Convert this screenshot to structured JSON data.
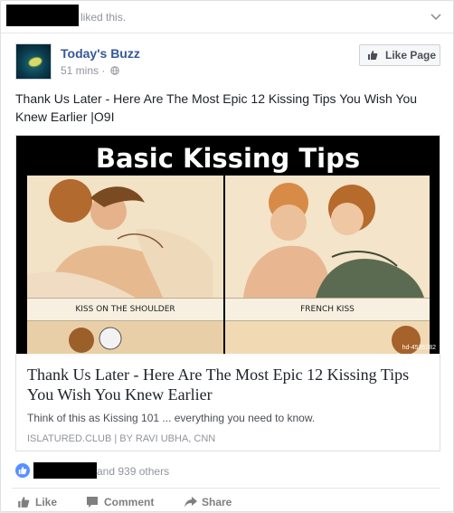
{
  "story": {
    "liked_text": "liked this.",
    "page_name": "Today's Buzz",
    "time": "51 mins",
    "separator": "·",
    "like_page_label": "Like Page",
    "post_text": "Thank Us Later - Here Are The Most Epic 12 Kissing Tips You Wish You Knew Earlier |O9I"
  },
  "link_preview": {
    "image_title": "Basic Kissing Tips",
    "left_caption": "KISS ON THE SHOULDER",
    "right_caption": "FRENCH KISS",
    "watermark": "hd-4535282",
    "title": "Thank Us Later - Here Are The Most Epic 12 Kissing Tips You Wish You Knew Earlier",
    "description": "Think of this as Kissing 101 ... everything you need to know.",
    "source": "ISLATURED.CLUB | BY RAVI UBHA, CNN"
  },
  "reactions": {
    "text": "and 939 others"
  },
  "actions": {
    "like": "Like",
    "comment": "Comment",
    "share": "Share"
  },
  "icons": {
    "header": "chevron-down-icon",
    "meta": "globe-icon",
    "like_page": "thumbs-up-icon",
    "reaction": "like-reaction-icon",
    "comment": "comment-icon",
    "share": "share-icon"
  },
  "colors": {
    "link_blue": "#365899",
    "like_bubble": "#5890ff",
    "muted_text": "#90949c"
  }
}
